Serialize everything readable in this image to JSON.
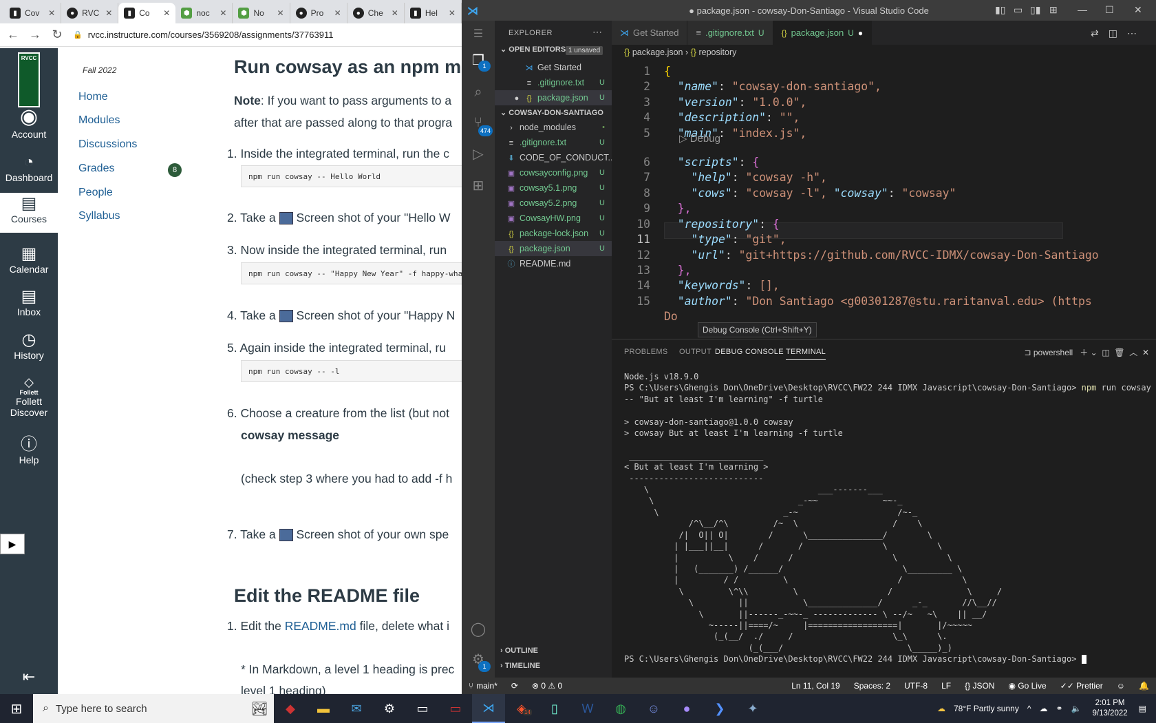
{
  "browser": {
    "tabs": [
      {
        "label": "Cov",
        "icon": "canvas-icon"
      },
      {
        "label": "RVC",
        "icon": "github-icon"
      },
      {
        "label": "Co",
        "icon": "canvas-icon",
        "active": true
      },
      {
        "label": "noc",
        "icon": "node-icon"
      },
      {
        "label": "No",
        "icon": "node-icon"
      },
      {
        "label": "Pro",
        "icon": "github-icon"
      },
      {
        "label": "Che",
        "icon": "github-icon"
      },
      {
        "label": "Hel",
        "icon": "canvas-icon"
      }
    ],
    "url": "rvcc.instructure.com/courses/3569208/assignments/37763911"
  },
  "canvas_rail": {
    "logo": "RVCC",
    "items": [
      {
        "label": "Account",
        "icon": "account-icon"
      },
      {
        "label": "Dashboard",
        "icon": "dashboard-icon"
      },
      {
        "label": "Courses",
        "icon": "courses-icon"
      },
      {
        "label": "Calendar",
        "icon": "calendar-icon"
      },
      {
        "label": "Inbox",
        "icon": "inbox-icon"
      },
      {
        "label": "History",
        "icon": "history-icon"
      },
      {
        "label": "Follett",
        "sub": "Follett Discover",
        "icon": "follett-icon"
      },
      {
        "label": "Help",
        "icon": "help-icon"
      }
    ]
  },
  "course_nav": {
    "term": "Fall 2022",
    "items": [
      "Home",
      "Modules",
      "Discussions",
      "Grades",
      "People",
      "Syllabus"
    ],
    "grades_badge": "8"
  },
  "content": {
    "heading1": "Run cowsay as an npm mod",
    "note_bold": "Note",
    "note_rest": ": If you want to pass arguments to a",
    "note_line2": "after that are passed along to that progra",
    "step1": "1. Inside the integrated terminal, run the c",
    "code1": "npm run cowsay -- Hello World",
    "step2": "2. Take a",
    "step2_rest": "Screen shot of your \"Hello W",
    "step3": "3. Now inside the integrated terminal, run",
    "code3": "npm run cowsay -- \"Happy New Year\" -f happy-wha",
    "step4": "4. Take a",
    "step4_rest": "Screen shot of your \"Happy N",
    "step5": "5. Again inside the integrated terminal, ru",
    "code5": "npm run cowsay -- -l",
    "step6": "6. Choose a creature from the list (but not",
    "step6_bold": "cowsay message",
    "step6_note": "(check step 3 where you had to add -f h",
    "step7": "7. Take a",
    "step7_rest": "Screen shot of your own spe",
    "heading2": "Edit the README file",
    "readme1_a": "1. Edit the",
    "readme1_link": "README.md",
    "readme1_b": "file, delete what i",
    "readme_note": "* In Markdown, a level 1 heading is prec",
    "readme_note2": "level 1 heading)"
  },
  "vscode": {
    "title": "● package.json - cowsay-Don-Santiago - Visual Studio Code",
    "explorer_label": "EXPLORER",
    "open_editors_label": "OPEN EDITORS",
    "unsaved_badge": "1 unsaved",
    "open_editors": [
      {
        "name": "Get Started",
        "icon": "vscode-icon",
        "status": ""
      },
      {
        "name": ".gitignore.txt",
        "icon": "text-file-icon",
        "status": "U"
      },
      {
        "name": "package.json",
        "icon": "json-icon",
        "status": "U",
        "modified": true
      }
    ],
    "project_label": "COWSAY-DON-SANTIAGO",
    "files": [
      {
        "name": "node_modules",
        "icon": "folder-icon",
        "status": "•"
      },
      {
        "name": ".gitignore.txt",
        "icon": "text-file-icon",
        "status": "U"
      },
      {
        "name": "CODE_OF_CONDUCT....",
        "icon": "download-file-icon",
        "status": ""
      },
      {
        "name": "cowsayconfig.png",
        "icon": "image-file-icon",
        "status": "U"
      },
      {
        "name": "cowsay5.1.png",
        "icon": "image-file-icon",
        "status": "U"
      },
      {
        "name": "cowsay5.2.png",
        "icon": "image-file-icon",
        "status": "U"
      },
      {
        "name": "CowsayHW.png",
        "icon": "image-file-icon",
        "status": "U"
      },
      {
        "name": "package-lock.json",
        "icon": "json-icon",
        "status": "U"
      },
      {
        "name": "package.json",
        "icon": "json-icon",
        "status": "U"
      },
      {
        "name": "README.md",
        "icon": "info-file-icon",
        "status": ""
      }
    ],
    "outline_label": "OUTLINE",
    "timeline_label": "TIMELINE",
    "activity_badges": {
      "explorer": "1",
      "scm": "474",
      "settings": "1"
    },
    "tabs": [
      {
        "label": "Get Started",
        "status": ""
      },
      {
        "label": ".gitignore.txt",
        "status": "U"
      },
      {
        "label": "package.json",
        "status": "U",
        "modified": true
      }
    ],
    "breadcrumb": [
      "package.json",
      "repository"
    ],
    "code_lines": [
      {
        "n": "1",
        "t": "{"
      },
      {
        "n": "2",
        "k": "\"name\"",
        "v": "\"cowsay-don-santiago\","
      },
      {
        "n": "3",
        "k": "\"version\"",
        "v": "\"1.0.0\","
      },
      {
        "n": "4",
        "k": "\"description\"",
        "v": "\"\","
      },
      {
        "n": "5",
        "k": "\"main\"",
        "v": "\"index.js\","
      },
      {
        "n": "6",
        "k": "\"scripts\"",
        "v": "{"
      },
      {
        "n": "7",
        "k": "\"help\"",
        "v": "\"cowsay -h\","
      },
      {
        "n": "8",
        "k": "\"cows\"",
        "v": "\"cowsay -l\",",
        "k2": "\"cowsay\"",
        "v2": "\"cowsay\""
      },
      {
        "n": "9",
        "t": "},"
      },
      {
        "n": "10",
        "k": "\"repository\"",
        "v": "{"
      },
      {
        "n": "11",
        "k": "\"type\"",
        "v": "\"git\","
      },
      {
        "n": "12",
        "k": "\"url\"",
        "v": "\"git+https://github.com/RVCC-IDMX/cowsay-Don-Santiago"
      },
      {
        "n": "13",
        "t": "},"
      },
      {
        "n": "14",
        "k": "\"keywords\"",
        "v": "[],"
      },
      {
        "n": "15",
        "k": "\"author\"",
        "v": "\"Don Santiago <g00301287@stu.raritanval.edu> (https"
      },
      {
        "n": "",
        "t": "Do"
      }
    ],
    "debug_lens": "Debug",
    "tooltip": "Debug Console (Ctrl+Shift+Y)",
    "panel_tabs": [
      "PROBLEMS",
      "OUTPUT",
      "DEBUG CONSOLE",
      "TERMINAL"
    ],
    "terminal_shell": "powershell",
    "terminal_lines": [
      "Node.js v18.9.0",
      "PS C:\\Users\\Ghengis Don\\OneDrive\\Desktop\\RVCC\\FW22 244 IDMX Javascript\\cowsay-Don-Santiago> npm run cowsay",
      "-- \"But at least I'm learning\" -f turtle",
      "",
      "> cowsay-don-santiago@1.0.0 cowsay",
      "> cowsay But at least I'm learning -f turtle",
      "",
      " ___________________________",
      "< But at least I'm learning >",
      " ---------------------------",
      "    \\                                  ___-------___",
      "     \\                             _-~~             ~~-_",
      "      \\                         _-~                    /~-_",
      "             /^\\__/^\\         /~  \\                   /    \\",
      "           /|  O|| O|        /      \\_______________/        \\",
      "          | |___||__|      /       /                \\          \\",
      "          |          \\    /      /                    \\          \\",
      "          |   (_______) /______/                        \\_________ \\",
      "          |         / /         \\                      /            \\",
      "           \\         \\^\\\\         \\                  /               \\     /",
      "             \\         ||           \\______________/      _-_       //\\__//",
      "               \\       ||------_-~~-_ ------------- \\ --/~   ~\\    || __/",
      "                 ~-----||====/~     |==================|       |/~~~~~",
      "                  (_(__/  ./     /                    \\_\\      \\.",
      "                         (_(___/                         \\_____)_)",
      "PS C:\\Users\\Ghengis Don\\OneDrive\\Desktop\\RVCC\\FW22 244 IDMX Javascript\\cowsay-Don-Santiago> "
    ],
    "status": {
      "branch": "main*",
      "problems": "⊗ 0 ⚠ 0",
      "position": "Ln 11, Col 19",
      "spaces": "Spaces: 2",
      "encoding": "UTF-8",
      "eol": "LF",
      "language": "JSON",
      "golive": "Go Live",
      "prettier": "Prettier"
    }
  },
  "taskbar": {
    "search_placeholder": "Type here to search",
    "weather": "78°F  Partly sunny",
    "time": "2:01 PM",
    "date": "9/13/2022",
    "notification_count": "14"
  }
}
